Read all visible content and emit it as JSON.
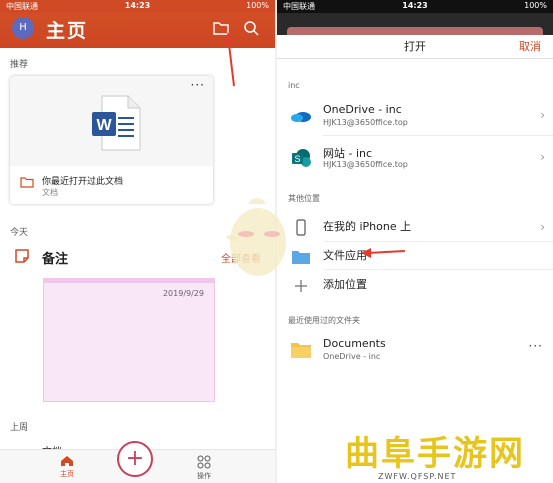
{
  "left": {
    "status": {
      "carrier": "中国联通",
      "time": "14:23",
      "battery": "100%"
    },
    "header": {
      "avatar": "H",
      "title": "主页"
    },
    "recommended_label": "推荐",
    "recent_card": {
      "name": "你最近打开过此文档",
      "type": "文档",
      "more": "···"
    },
    "today_label": "今天",
    "notes": {
      "title": "备注",
      "see_all": "全部查看",
      "date": "2019/9/29"
    },
    "last_week_label": "上周",
    "doc_item": "文档",
    "tabs": {
      "home": "主页",
      "actions": "操作",
      "add": "+"
    }
  },
  "right": {
    "status": {
      "carrier": "中国联通",
      "time": "14:23",
      "battery": "100%"
    },
    "sheet": {
      "title": "打开",
      "cancel": "取消"
    },
    "inc_label": "inc",
    "onedrive": {
      "name": "OneDrive - inc",
      "account": "HJK13@3650ffice.top"
    },
    "site": {
      "name": "网站 - inc",
      "account": "HJK13@3650ffice.top"
    },
    "other_label": "其他位置",
    "on_iphone": "在我的 iPhone 上",
    "files_app": "文件应用",
    "add_location": "添加位置",
    "recent_folders_label": "最近使用过的文件夹",
    "documents": {
      "name": "Documents",
      "location": "OneDrive - inc",
      "more": "···"
    }
  },
  "watermark": {
    "main": "曲阜手游网",
    "sub": "ZWFW.QFSP.NET"
  },
  "colors": {
    "accent": "#d04a25",
    "fab": "#c8415a",
    "note": "#f9e6f7",
    "word": "#2b579a"
  }
}
